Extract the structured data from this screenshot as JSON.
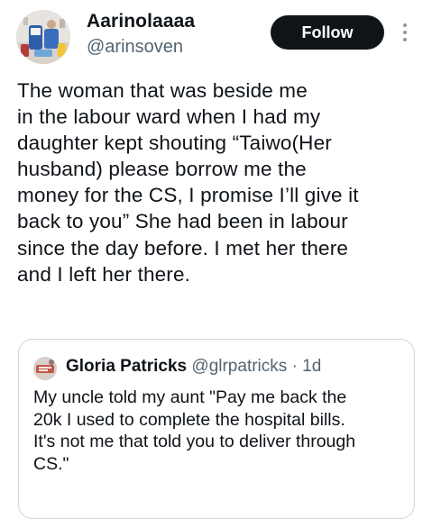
{
  "author": {
    "display_name": "Aarinolaaaa",
    "handle": "@arinsoven",
    "avatar_icon": "profile-photo"
  },
  "follow_button": {
    "label": "Follow"
  },
  "more_menu": {
    "icon": "vertical-ellipsis-icon"
  },
  "tweet": {
    "lines": [
      "The woman that was beside me",
      "in the labour ward when I had my",
      "daughter kept shouting “Taiwo(Her",
      "husband) please borrow me the",
      "money for the CS, I promise I’ll give it",
      "back to you” She had been in labour",
      "since the day before. I met her there",
      "and I left her there."
    ]
  },
  "quote": {
    "display_name": "Gloria Patricks",
    "handle": "@glrpatricks",
    "separator": "·",
    "time": "1d",
    "avatar_icon": "profile-photo",
    "lines": [
      "My uncle told my aunt \"Pay me back the",
      "20k I used to complete the hospital bills.",
      "It's not me that told you to deliver through",
      "CS.\""
    ]
  },
  "colors": {
    "text_primary": "#0f1419",
    "text_secondary": "#536471",
    "follow_bg": "#0f1419",
    "border": "#cfd9de"
  }
}
